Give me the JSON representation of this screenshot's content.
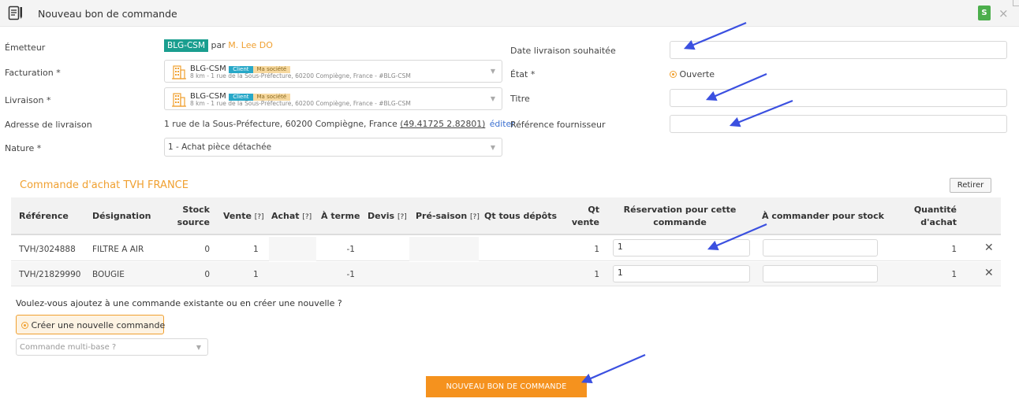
{
  "header": {
    "title": "Nouveau bon de commande",
    "badge": "S"
  },
  "form": {
    "emetteur_label": "Émetteur",
    "emetteur_code": "BLG-CSM",
    "emetteur_par": "par",
    "emetteur_user": "M. Lee DO",
    "facturation_label": "Facturation *",
    "livraison_label": "Livraison *",
    "addr_name": "BLG-CSM",
    "tag_client": "Client",
    "tag_societe": "Ma société",
    "addr_line": "8 km - 1 rue de la Sous-Préfecture, 60200 Compiègne, France - #BLG-CSM",
    "adresse_label": "Adresse de livraison",
    "adresse_value": "1 rue de la Sous-Préfecture, 60200 Compiègne, France",
    "adresse_coords": "(49.41725 2.82801)",
    "adresse_edit": "éditer",
    "nature_label": "Nature *",
    "nature_value": "1 - Achat pièce détachée",
    "date_label": "Date livraison souhaitée",
    "etat_label": "État *",
    "etat_value": "Ouverte",
    "titre_label": "Titre",
    "ref_label": "Référence fournisseur"
  },
  "section": {
    "title": "Commande d'achat TVH FRANCE",
    "retirer": "Retirer"
  },
  "table": {
    "headers": {
      "reference": "Référence",
      "designation": "Désignation",
      "stock1": "Stock",
      "stock2": "source",
      "vente": "Vente",
      "achat": "Achat",
      "help": "[?]",
      "aterme": "À terme",
      "devis": "Devis",
      "presaison": "Pré-saison",
      "qtdepots": "Qt tous dépôts",
      "qtvente1": "Qt",
      "qtvente2": "vente",
      "reservation1": "Réservation pour cette",
      "reservation2": "commande",
      "acommander": "À commander pour stock",
      "quantite1": "Quantité",
      "quantite2": "d'achat"
    },
    "rows": [
      {
        "reference": "TVH/3024888",
        "designation": "FILTRE A AIR",
        "stock": "0",
        "vente": "1",
        "aterme": "-1",
        "qtvente": "1",
        "reservation": "1",
        "quantite": "1"
      },
      {
        "reference": "TVH/21829990",
        "designation": "BOUGIE",
        "stock": "0",
        "vente": "1",
        "aterme": "-1",
        "qtvente": "1",
        "reservation": "1",
        "quantite": "1"
      }
    ]
  },
  "footer": {
    "question": "Voulez-vous ajoutez à une commande existante ou en créer une nouvelle ?",
    "radio_label": "Créer une nouvelle commande",
    "multibase_placeholder": "Commande multi-base ?",
    "submit": "NOUVEAU BON DE COMMANDE"
  },
  "colors": {
    "accent": "#f0a030",
    "teal": "#1a9e8f",
    "arrow": "#3b50e0"
  }
}
